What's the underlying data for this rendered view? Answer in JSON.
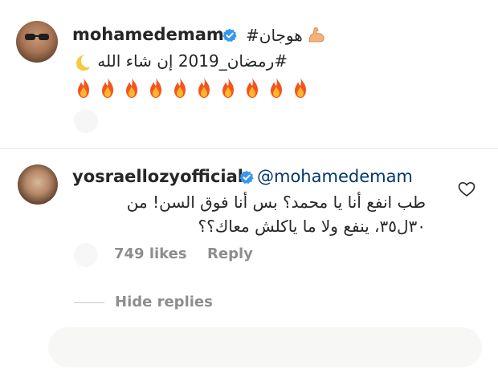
{
  "post": {
    "username": "mohamedemam",
    "caption_line1": "هوجان#",
    "caption_line2": "#رمضان_2019 إن شاء الله",
    "fire_count": 10
  },
  "comment": {
    "username": "yosraellozyofficial",
    "mention": "@mohamedemam",
    "text_line1": "طب انفع أنا يا محمد؟ بس أنا فوق السن! من",
    "text_line2": "٣٠ل٣٥، ينفع ولا ما ياكلش معاك؟؟",
    "likes": "749 likes",
    "reply_label": "Reply",
    "hide_replies_label": "Hide replies"
  },
  "colors": {
    "text": "#262626",
    "muted": "#8e8e8e",
    "link": "#00376b",
    "verified": "#3897f0"
  },
  "icons": [
    "verified-badge-icon",
    "flexed-biceps-icon",
    "crescent-moon-icon",
    "fire-icon",
    "heart-outline-icon"
  ]
}
